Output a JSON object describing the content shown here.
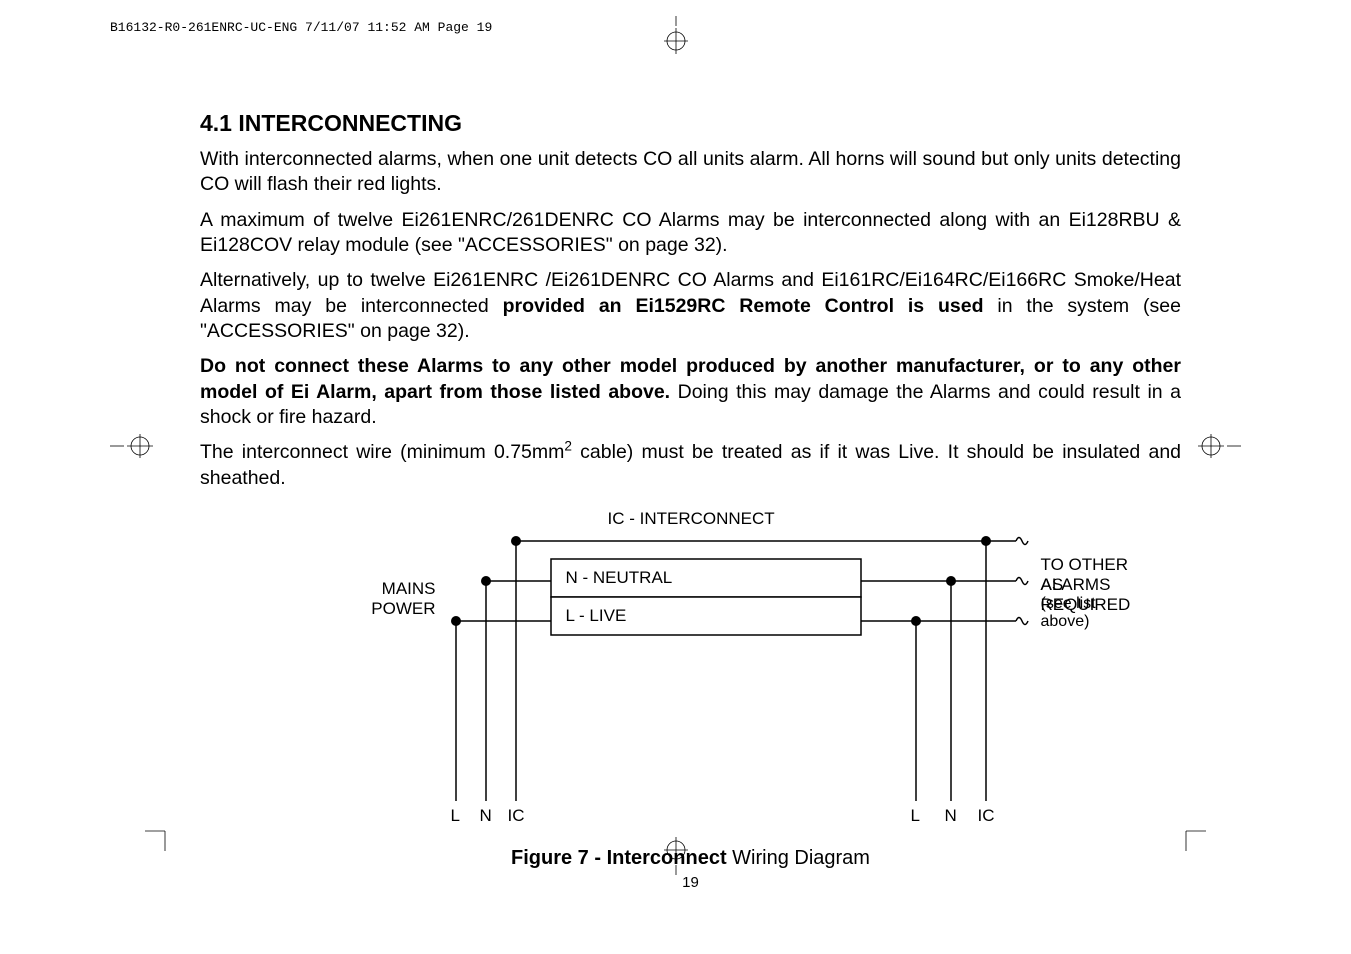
{
  "meta": {
    "header": "B16132-R0-261ENRC-UC-ENG  7/11/07  11:52 AM  Page 19"
  },
  "section": {
    "title": "4.1 INTERCONNECTING",
    "p1": "With interconnected alarms, when one unit detects CO all units alarm. All horns will sound but only units detecting CO will flash their red lights.",
    "p2": "A maximum of twelve Ei261ENRC/261DENRC CO Alarms may be interconnected along with an Ei128RBU & Ei128COV relay module (see \"ACCESSORIES\" on page 32).",
    "p3a": "Alternatively, up to twelve Ei261ENRC /Ei261DENRC CO Alarms and Ei161RC/Ei164RC/Ei166RC Smoke/Heat Alarms may be interconnected ",
    "p3b_bold": "provided an Ei1529RC Remote Control is used",
    "p3c": " in the system (see \"ACCESSORIES\" on page 32).",
    "p4a_bold": "Do not connect these Alarms to any other model produced by another manufacturer, or to any other model of Ei Alarm, apart from those listed above.",
    "p4b": " Doing this may damage the Alarms and could result in a shock or fire hazard.",
    "p5a": "The interconnect wire (minimum 0.75mm",
    "p5sup": "2",
    "p5b": " cable) must be treated as if it was Live. It should be insulated and sheathed."
  },
  "diagram": {
    "ic_label": "IC - INTERCONNECT",
    "n_label": "N - NEUTRAL",
    "l_label": "L - LIVE",
    "mains1": "MAINS",
    "mains2": "POWER",
    "right1": "TO OTHER ALARMS",
    "right2": "AS REQUIRED",
    "right3": "(see list above)",
    "term_L": "L",
    "term_N": "N",
    "term_IC": "IC",
    "figure_caption_bold": "Figure 7 - Interconnect",
    "figure_caption_rest": " Wiring Diagram",
    "page_number": "19"
  }
}
